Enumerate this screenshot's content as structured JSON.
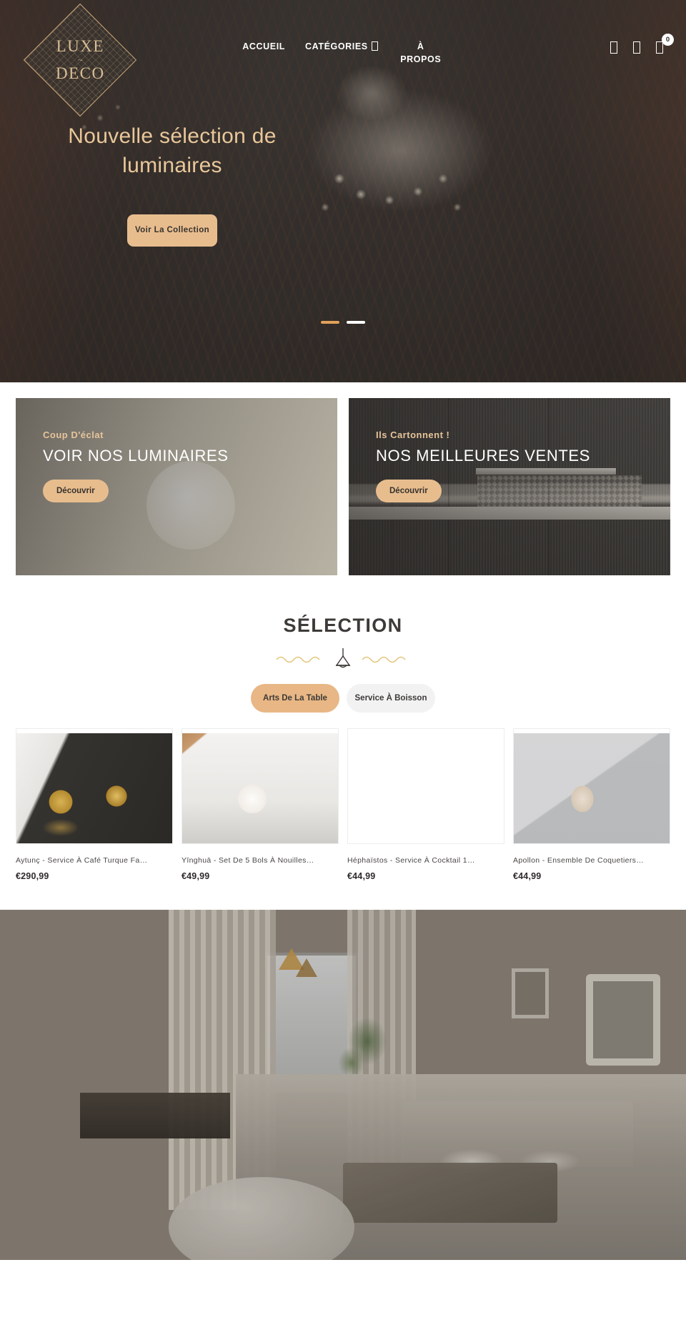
{
  "header": {
    "logo": {
      "line1": "LUXE",
      "ornament": "~",
      "line2": "DECO",
      "name": "luxe-deco-logo"
    },
    "nav": [
      {
        "label": "ACCUEIL",
        "has_dropdown": false
      },
      {
        "label": "CATÉGORIES",
        "has_dropdown": true
      },
      {
        "label": "À PROPOS",
        "has_dropdown": false
      }
    ],
    "icons": [
      {
        "name": "search-icon",
        "glyph": "□"
      },
      {
        "name": "user-account-icon",
        "glyph": "□"
      },
      {
        "name": "cart-icon",
        "glyph": "□"
      }
    ],
    "cart_count": "0"
  },
  "hero": {
    "title": "Nouvelle sélection de luminaires",
    "cta_label": "Voir La Collection",
    "slides": [
      {
        "index": "1",
        "active": true
      },
      {
        "index": "2",
        "active": false
      }
    ],
    "accent_color": "#e8bd8e",
    "title_color": "#e9c79a"
  },
  "promos": [
    {
      "kicker": "Coup D'éclat",
      "title": "VOIR NOS LUMINAIRES",
      "cta_label": "Découvrir"
    },
    {
      "kicker": "Ils Cartonnent !",
      "title": "NOS MEILLEURES VENTES",
      "cta_label": "Découvrir"
    }
  ],
  "selection": {
    "heading": "SÉLECTION",
    "divider_icon": "pendant-lamp-icon",
    "divider_color": "#e3c77e",
    "tabs": [
      {
        "label": "Arts De La Table",
        "active": true
      },
      {
        "label": "Service À Boisson",
        "active": false
      }
    ],
    "products": [
      {
        "name": "Aytunç - Service À Café Turque Fa…",
        "price": "€290,99"
      },
      {
        "name": "Yīnghuā - Set De 5 Bols À Nouilles…",
        "price": "€49,99"
      },
      {
        "name": "Héphaïstos - Service À Cocktail 1…",
        "price": "€44,99"
      },
      {
        "name": "Apollon - Ensemble De Coquetiers…",
        "price": "€44,99"
      }
    ]
  }
}
